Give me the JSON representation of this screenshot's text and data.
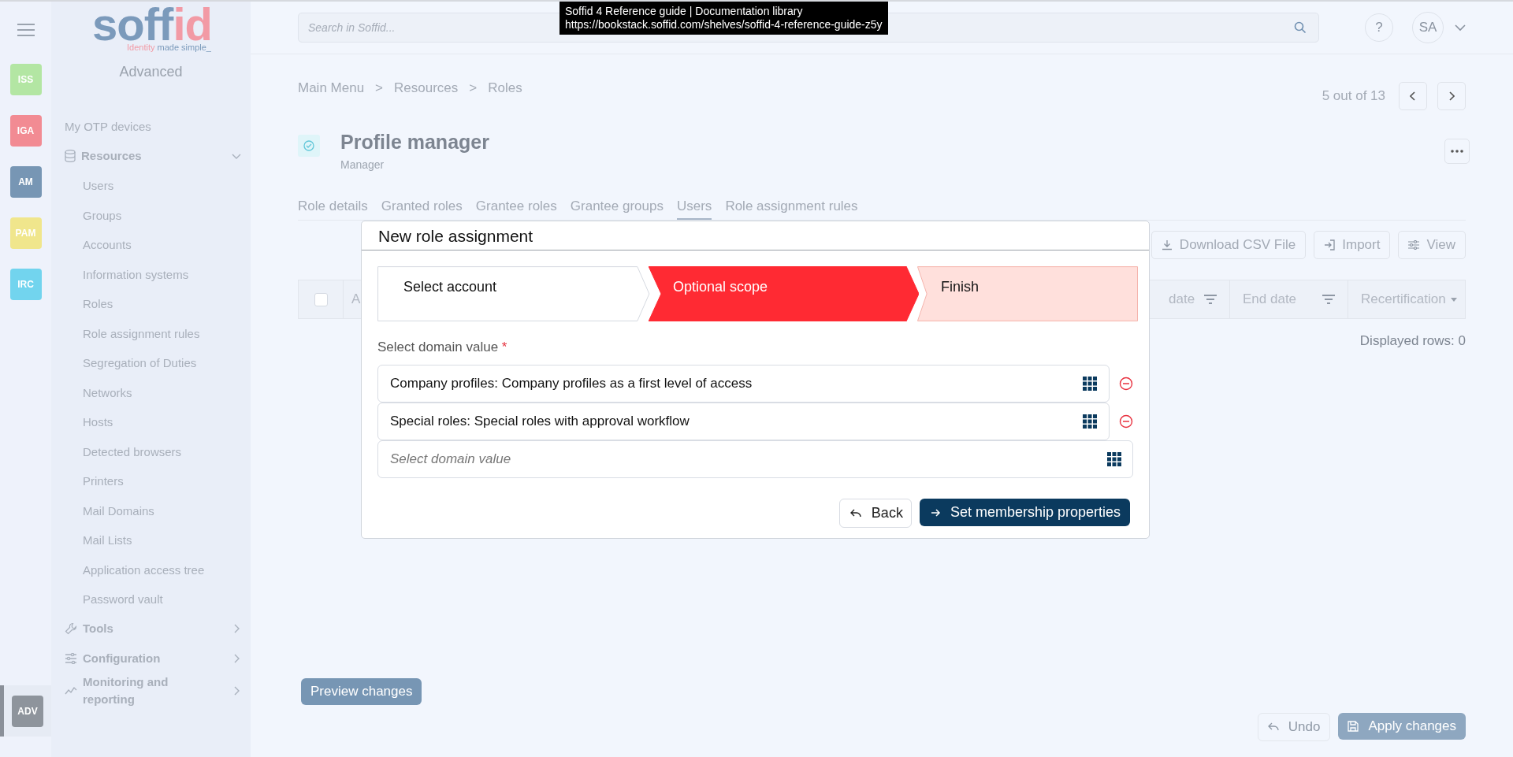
{
  "tooltip": {
    "title": "Soffid 4 Reference guide | Documentation library",
    "url": "https://bookstack.soffid.com/shelves/soffid-4-reference-guide-z5y"
  },
  "rail": [
    {
      "label": "ISS",
      "color": "#b3e6a3",
      "selected": false
    },
    {
      "label": "IGA",
      "color": "#f28b93",
      "selected": false
    },
    {
      "label": "AM",
      "color": "#7796b4",
      "selected": false
    },
    {
      "label": "PAM",
      "color": "#f0e68c",
      "selected": false
    },
    {
      "label": "IRC",
      "color": "#72d4ee",
      "selected": false
    },
    {
      "label": "ADV",
      "color": "#8e949c",
      "selected": true
    }
  ],
  "logo": {
    "name_start": "soff",
    "name_end": "id",
    "tagline_start": "Identity",
    "tagline_end": "made simple_"
  },
  "sidebar": {
    "title": "Advanced",
    "items": [
      {
        "label": "My OTP devices",
        "kind": "link"
      },
      {
        "label": "Resources",
        "kind": "section",
        "expanded": true,
        "children": [
          {
            "label": "Users"
          },
          {
            "label": "Groups"
          },
          {
            "label": "Accounts"
          },
          {
            "label": "Information systems"
          },
          {
            "label": "Roles"
          },
          {
            "label": "Role assignment rules"
          },
          {
            "label": "Segregation of Duties"
          },
          {
            "label": "Networks"
          },
          {
            "label": "Hosts"
          },
          {
            "label": "Detected browsers"
          },
          {
            "label": "Printers"
          },
          {
            "label": "Mail Domains"
          },
          {
            "label": "Mail Lists"
          },
          {
            "label": "Application access tree"
          },
          {
            "label": "Password vault"
          }
        ]
      },
      {
        "label": "Tools",
        "kind": "section",
        "expanded": false
      },
      {
        "label": "Configuration",
        "kind": "section",
        "expanded": false
      },
      {
        "label": "Monitoring and reporting",
        "kind": "section",
        "expanded": false
      }
    ]
  },
  "search": {
    "placeholder": "Search in Soffid..."
  },
  "help": "?",
  "user": "SA",
  "breadcrumb": [
    "Main Menu",
    "Resources",
    "Roles"
  ],
  "breadcrumb_separator": ">",
  "pager": "5 out of 13",
  "page": {
    "title": "Profile manager",
    "subtitle": "Manager"
  },
  "tabs": [
    {
      "label": "Role details",
      "selected": false
    },
    {
      "label": "Granted roles",
      "selected": false
    },
    {
      "label": "Grantee roles",
      "selected": false
    },
    {
      "label": "Grantee groups",
      "selected": false
    },
    {
      "label": "Users",
      "selected": true
    },
    {
      "label": "Role assignment rules",
      "selected": false
    }
  ],
  "toolbar": [
    "Download CSV File",
    "Import",
    "View"
  ],
  "table": {
    "select_all_checked": false,
    "columns": [
      "A",
      "date",
      "End date",
      "Recertification"
    ],
    "footer": "Displayed rows: 0"
  },
  "dialog": {
    "title": "New role assignment",
    "steps": [
      {
        "label": "Select account",
        "completed": true,
        "selected": false
      },
      {
        "label": "Optional scope",
        "completed": false,
        "selected": true
      },
      {
        "label": "Finish",
        "completed": false,
        "selected": false
      }
    ],
    "field_label": "Select domain value",
    "required_mark": "*",
    "values": [
      {
        "kind": "value",
        "text": "Company profiles: Company profiles as a first level of access"
      },
      {
        "kind": "value",
        "text": "Special roles: Special roles with approval workflow"
      },
      {
        "kind": "empty",
        "placeholder": "Select domain value"
      }
    ],
    "buttons": [
      "Back",
      "Set membership properties"
    ]
  },
  "preview_button": "Preview changes",
  "undo_button": {
    "label": "Undo",
    "disabled": true
  },
  "apply_button": {
    "label": "Apply changes",
    "disabled": true
  }
}
